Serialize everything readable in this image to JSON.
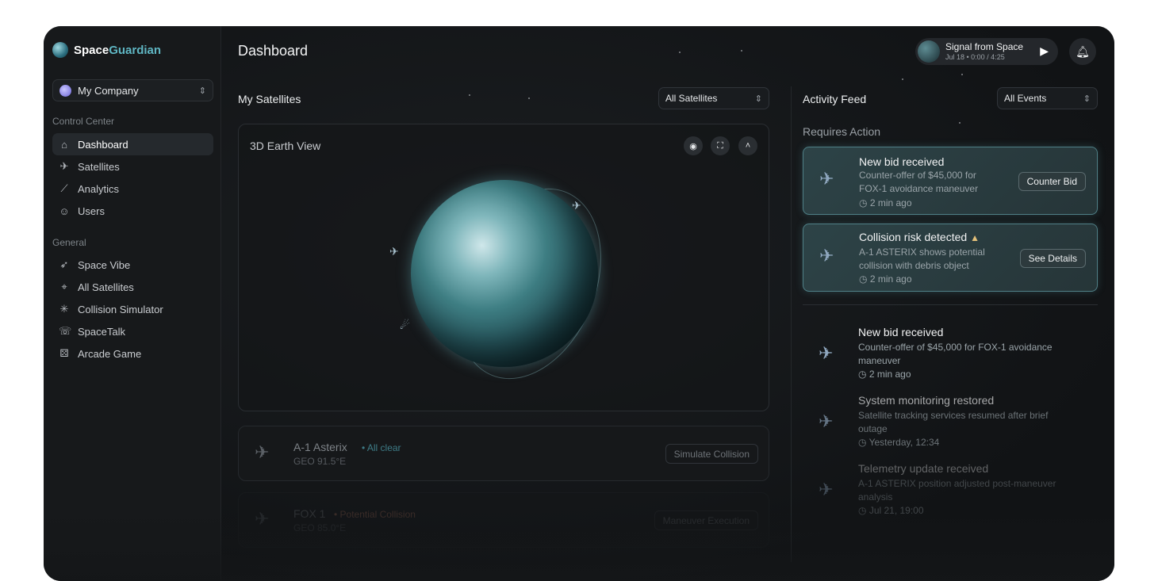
{
  "brand": {
    "part1": "Space",
    "part2": "Guardian"
  },
  "company": {
    "name": "My Company"
  },
  "sidebar": {
    "section1": "Control Center",
    "items1": [
      {
        "label": "Dashboard",
        "icon": "home-icon"
      },
      {
        "label": "Satellites",
        "icon": "satellite-icon"
      },
      {
        "label": "Analytics",
        "icon": "chart-icon"
      },
      {
        "label": "Users",
        "icon": "users-icon"
      }
    ],
    "section2": "General",
    "items2": [
      {
        "label": "Space Vibe",
        "icon": "rocket-icon"
      },
      {
        "label": "All Satellites",
        "icon": "satellite-dish-icon"
      },
      {
        "label": "Collision Simulator",
        "icon": "sparkle-icon"
      },
      {
        "label": "SpaceTalk",
        "icon": "chat-icon"
      },
      {
        "label": "Arcade Game",
        "icon": "gamepad-icon"
      }
    ]
  },
  "header": {
    "title": "Dashboard",
    "player": {
      "title": "Signal from Space",
      "subtitle": "Jul 18 • 0:00 / 4:25"
    }
  },
  "satellites": {
    "heading": "My Satellites",
    "filter": "All Satellites",
    "earth_label": "3D Earth View",
    "cards": [
      {
        "name": "A-1 Asterix",
        "status": "• All clear",
        "position": "GEO 91.5°E",
        "action": "Simulate Collision"
      },
      {
        "name": "FOX 1",
        "status": "• Potential Collision",
        "position": "GEO 85.0°E",
        "action": "Maneuver Execution"
      }
    ]
  },
  "activity": {
    "heading": "Activity Feed",
    "filter": "All Events",
    "requires_action": "Requires Action",
    "action_events": [
      {
        "title": "New bid received",
        "desc1": "Counter-offer of $45,000 for",
        "desc2": "FOX-1 avoidance maneuver",
        "time": "2 min ago",
        "button": "Counter Bid"
      },
      {
        "title": "Collision risk detected",
        "desc1": "A-1 ASTERIX shows potential",
        "desc2": "collision with debris object",
        "time": "2 min ago",
        "button": "See Details"
      }
    ],
    "events": [
      {
        "title": "New bid received",
        "desc1": "Counter-offer of $45,000 for FOX-1 avoidance",
        "desc2": "maneuver",
        "time": "2 min ago"
      },
      {
        "title": "System monitoring restored",
        "desc1": "Satellite tracking services resumed after brief",
        "desc2": "outage",
        "time": "Yesterday, 12:34"
      },
      {
        "title": "Telemetry update received",
        "desc1": "A-1 ASTERIX position adjusted post-maneuver",
        "desc2": "analysis",
        "time": "Jul 21, 19:00"
      }
    ]
  }
}
